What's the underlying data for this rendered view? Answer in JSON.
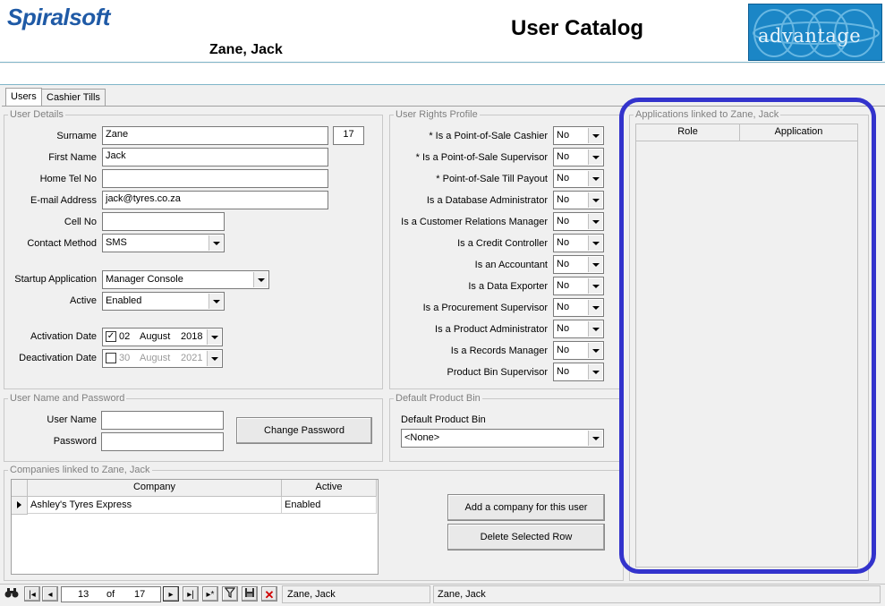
{
  "header": {
    "logo": "Spiralsoft",
    "user_name": "Zane, Jack",
    "title": "User Catalog",
    "badge": "advantage"
  },
  "tabs": [
    {
      "label": "Users"
    },
    {
      "label": "Cashier Tills"
    }
  ],
  "user_details": {
    "title": "User Details",
    "surname_label": "Surname",
    "surname": "Zane",
    "id": "17",
    "first_name_label": "First Name",
    "first_name": "Jack",
    "home_tel_label": "Home Tel No",
    "home_tel": "",
    "email_label": "E-mail Address",
    "email": "jack@tyres.co.za",
    "cell_label": "Cell No",
    "cell": "",
    "contact_method_label": "Contact Method",
    "contact_method": "SMS",
    "startup_app_label": "Startup Application",
    "startup_app": "Manager Console",
    "active_label": "Active",
    "active": "Enabled",
    "activation_label": "Activation Date",
    "activation": {
      "day": "02",
      "month": "August",
      "year": "2018",
      "checked": true
    },
    "deactivation_label": "Deactivation Date",
    "deactivation": {
      "day": "30",
      "month": "August",
      "year": "2021",
      "checked": false
    }
  },
  "rights": {
    "title": "User Rights Profile",
    "items": [
      {
        "label": "* Is a Point-of-Sale Cashier",
        "value": "No"
      },
      {
        "label": "* Is a Point-of-Sale Supervisor",
        "value": "No"
      },
      {
        "label": "* Point-of-Sale Till Payout",
        "value": "No"
      },
      {
        "label": "Is a Database Administrator",
        "value": "No"
      },
      {
        "label": "Is a Customer Relations Manager",
        "value": "No"
      },
      {
        "label": "Is a Credit Controller",
        "value": "No"
      },
      {
        "label": "Is an Accountant",
        "value": "No"
      },
      {
        "label": "Is a Data Exporter",
        "value": "No"
      },
      {
        "label": "Is a Procurement Supervisor",
        "value": "No"
      },
      {
        "label": "Is a Product Administrator",
        "value": "No"
      },
      {
        "label": "Is a Records Manager",
        "value": "No"
      },
      {
        "label": "Product Bin Supervisor",
        "value": "No"
      }
    ]
  },
  "credentials": {
    "title": "User Name and Password",
    "username_label": "User Name",
    "username": "",
    "password_label": "Password",
    "password": "",
    "change_button": "Change Password"
  },
  "bin": {
    "title": "Default Product Bin",
    "label": "Default Product Bin",
    "value": "<None>"
  },
  "companies": {
    "title": "Companies linked to Zane, Jack",
    "columns": [
      "Company",
      "Active"
    ],
    "rows": [
      {
        "company": "Ashley's Tyres Express",
        "active": "Enabled"
      }
    ],
    "add_button": "Add a company for this user",
    "delete_button": "Delete Selected Row"
  },
  "applications": {
    "title": "Applications linked to Zane, Jack",
    "columns": [
      "Role",
      "Application"
    ]
  },
  "navigator": {
    "position": "13",
    "of_label": "of",
    "total": "17",
    "status1": "Zane, Jack",
    "status2": "Zane, Jack"
  },
  "colors": {
    "highlight": "#3333cc",
    "brand": "#1f5aa6"
  }
}
